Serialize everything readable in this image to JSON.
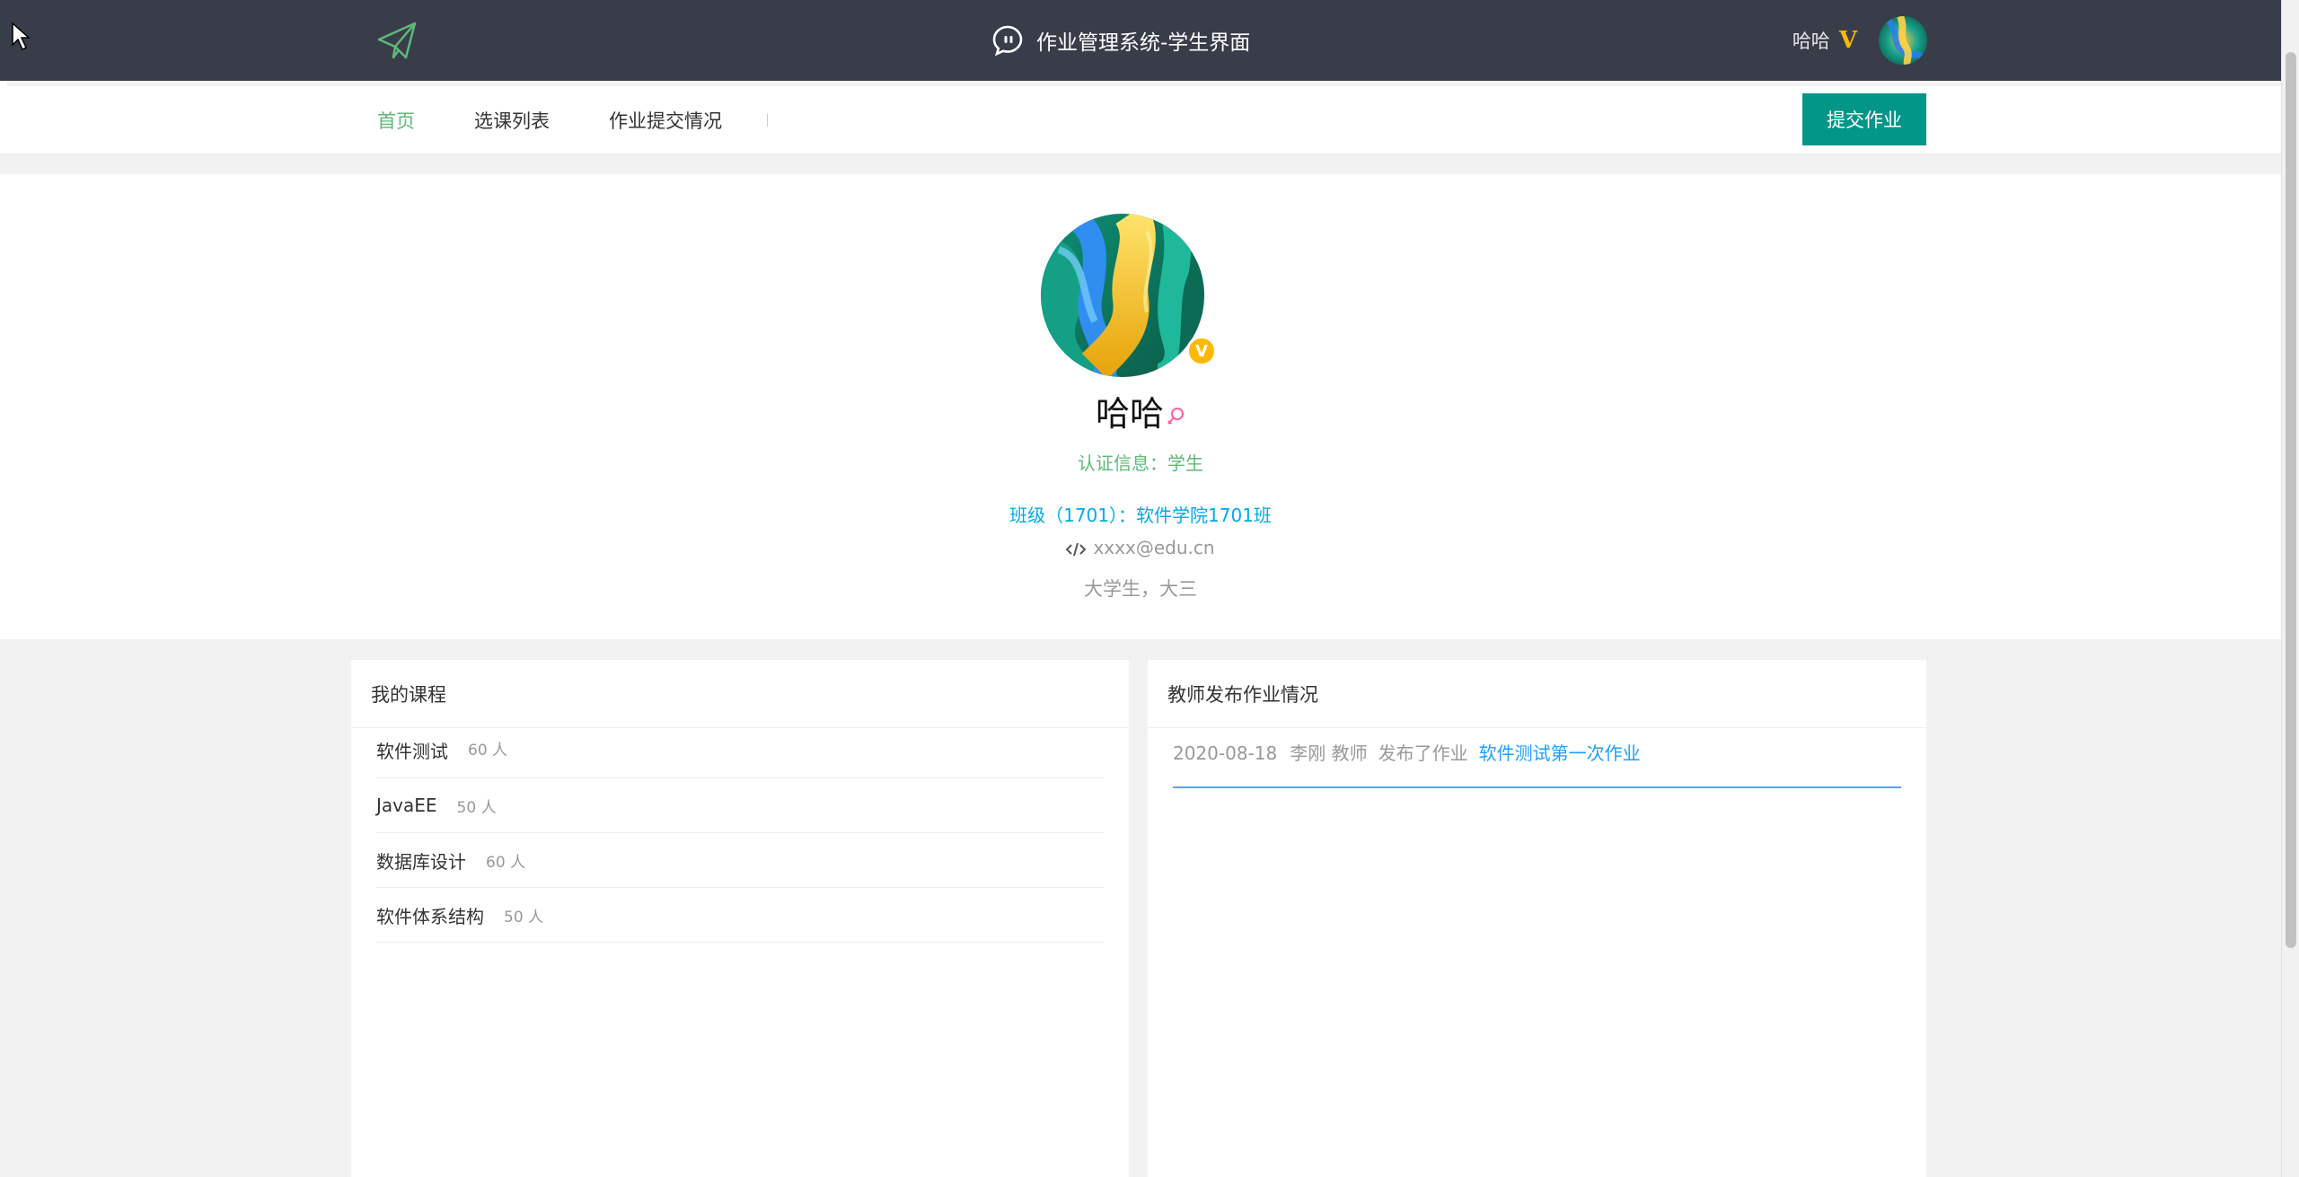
{
  "header": {
    "app_title": "作业管理系统-学生界面",
    "username": "哈哈",
    "vip_mark": "V"
  },
  "nav": {
    "items": [
      {
        "label": "首页",
        "active": true
      },
      {
        "label": "选课列表",
        "active": false
      },
      {
        "label": "作业提交情况",
        "active": false
      }
    ],
    "submit_button": "提交作业"
  },
  "profile": {
    "name": "哈哈",
    "vip_badge": "V",
    "certification": "认证信息：学生",
    "class_info": "班级（1701）：软件学院1701班",
    "email": "xxxx@edu.cn",
    "description": "大学生，大三"
  },
  "courses": {
    "title": "我的课程",
    "items": [
      {
        "name": "软件测试",
        "count": "60 人"
      },
      {
        "name": "JavaEE",
        "count": "50 人"
      },
      {
        "name": "数据库设计",
        "count": "60 人"
      },
      {
        "name": "软件体系结构",
        "count": "50 人"
      }
    ]
  },
  "assignments": {
    "title": "教师发布作业情况",
    "items": [
      {
        "date": "2020-08-18",
        "teacher": "李刚 教师",
        "action": "发布了作业",
        "homework": "软件测试第一次作业"
      }
    ]
  },
  "colors": {
    "topbar": "#393d49",
    "accent_green": "#5fb878",
    "button_teal": "#009688",
    "link_blue": "#01aaed",
    "vip_gold": "#ffb800"
  },
  "icons": [
    "cursor-icon",
    "paper-plane-icon",
    "chat-bubble-icon",
    "female-icon",
    "code-icon"
  ]
}
